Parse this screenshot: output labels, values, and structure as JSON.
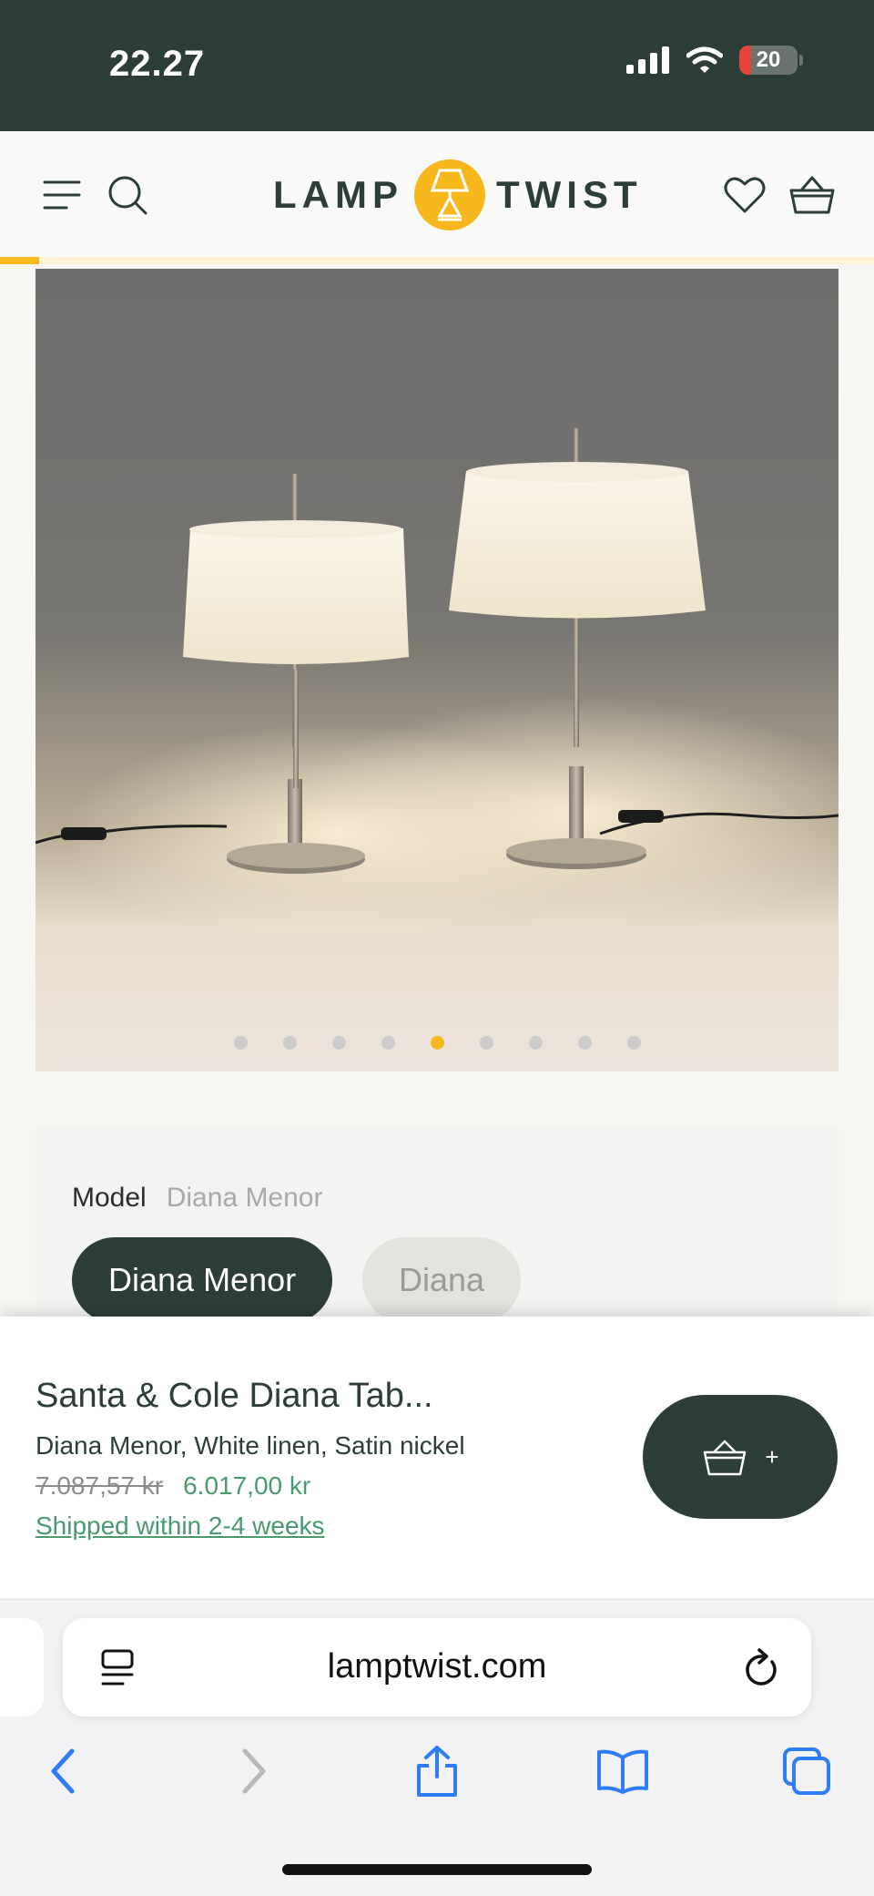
{
  "status_bar": {
    "time": "22.27",
    "battery": "20",
    "battery_level": 0.2
  },
  "header": {
    "logo_left": "LAMP",
    "logo_right": "TWIST",
    "icons": [
      "menu-icon",
      "search-icon",
      "lamp-logo-icon",
      "heart-icon",
      "basket-icon"
    ],
    "page_progress": 0.045
  },
  "gallery": {
    "image_count": 9,
    "active_index": 4
  },
  "options": {
    "model_label": "Model",
    "model_value": "Diana Menor",
    "choices": [
      "Diana Menor",
      "Diana"
    ],
    "selected": "Diana Menor"
  },
  "buy_bar": {
    "title": "Santa & Cole Diana Tab...",
    "variant": "Diana Menor, White linen, Satin nickel",
    "old_price": "7.087,57 kr",
    "price": "6.017,00 kr",
    "shipping": "Shipped within 2-4 weeks",
    "cart_plus": "+"
  },
  "browser": {
    "url": "lamptwist.com",
    "icons": [
      "reader-icon",
      "reload-icon",
      "back-icon",
      "forward-icon",
      "share-icon",
      "bookmarks-icon",
      "tabs-icon"
    ]
  },
  "colors": {
    "brand_dark": "#2c3e36",
    "brand_yellow": "#f6b81c",
    "price_green": "#4a9a6e"
  }
}
